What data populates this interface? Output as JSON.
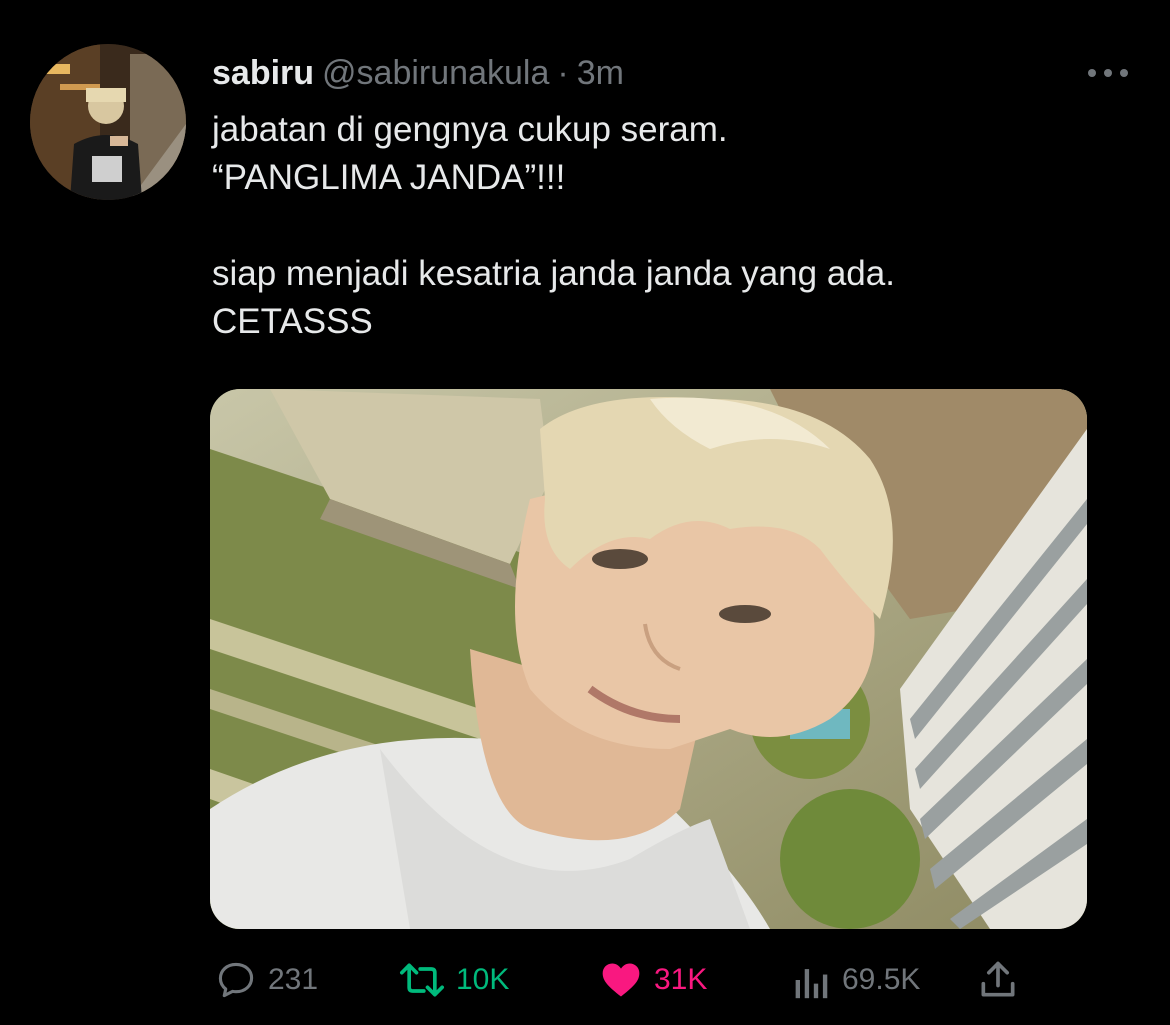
{
  "tweet": {
    "display_name": "sabiru",
    "handle": "@sabirunakula",
    "separator": "·",
    "time": "3m",
    "text_lines": [
      "jabatan di gengnya cukup seram.",
      "“PANGLIMA JANDA”!!!",
      "",
      "siap menjadi kesatria janda janda yang ada.",
      "CETASSS"
    ]
  },
  "actions": {
    "reply_count": "231",
    "retweet_count": "10K",
    "like_count": "31K",
    "view_count": "69.5K",
    "liked": true,
    "retweeted": true
  },
  "icons": {
    "avatar": "avatar-photo",
    "more": "more-icon",
    "reply": "reply-icon",
    "retweet": "retweet-icon",
    "like": "heart-icon",
    "views": "views-icon",
    "share": "share-icon"
  },
  "colors": {
    "background": "#000000",
    "text_primary": "#e7e9ea",
    "text_secondary": "#71767b",
    "retweet_green": "#00ba7c",
    "like_pink": "#f91880"
  }
}
